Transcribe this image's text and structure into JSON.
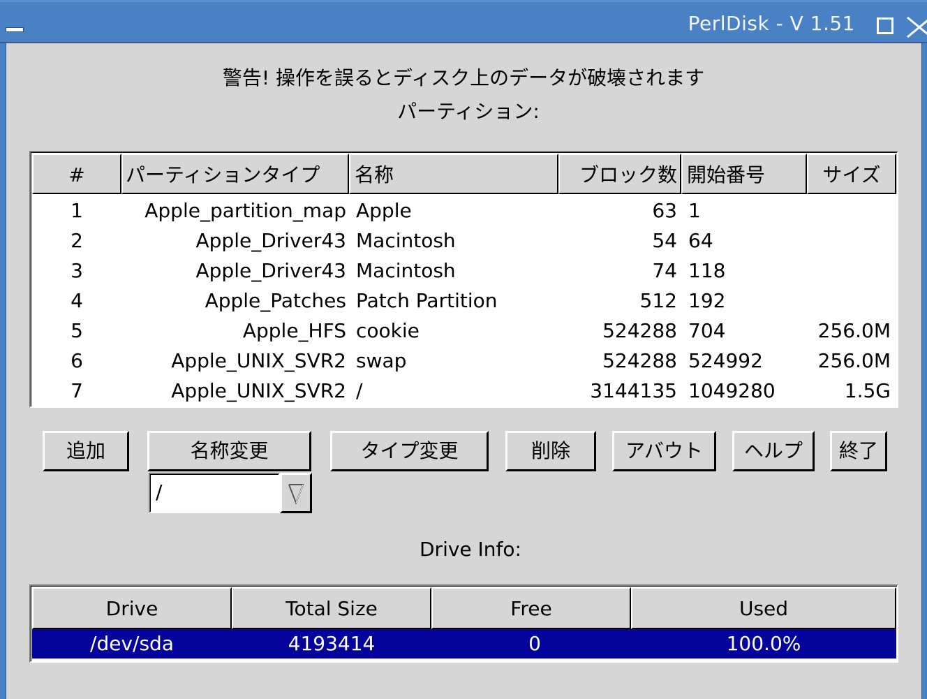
{
  "window": {
    "title": "PerlDisk - V 1.51"
  },
  "warning": "警告! 操作を誤るとディスク上のデータが破壊されます",
  "partitions_label": "パーティション:",
  "partition_table": {
    "headers": [
      "#",
      "パーティションタイプ",
      "名称",
      "ブロック数",
      "開始番号",
      "サイズ"
    ],
    "rows": [
      {
        "num": "1",
        "type": "Apple_partition_map",
        "name": "Apple",
        "blocks": "63",
        "start": "1",
        "size": ""
      },
      {
        "num": "2",
        "type": "Apple_Driver43",
        "name": "Macintosh",
        "blocks": "54",
        "start": "64",
        "size": ""
      },
      {
        "num": "3",
        "type": "Apple_Driver43",
        "name": "Macintosh",
        "blocks": "74",
        "start": "118",
        "size": ""
      },
      {
        "num": "4",
        "type": "Apple_Patches",
        "name": "Patch Partition",
        "blocks": "512",
        "start": "192",
        "size": ""
      },
      {
        "num": "5",
        "type": "Apple_HFS",
        "name": "cookie",
        "blocks": "524288",
        "start": "704",
        "size": "256.0M"
      },
      {
        "num": "6",
        "type": "Apple_UNIX_SVR2",
        "name": "swap",
        "blocks": "524288",
        "start": "524992",
        "size": "256.0M"
      },
      {
        "num": "7",
        "type": "Apple_UNIX_SVR2",
        "name": "/",
        "blocks": "3144135",
        "start": "1049280",
        "size": "1.5G"
      }
    ]
  },
  "buttons": {
    "add": "追加",
    "rename": "名称変更",
    "change_type": "タイプ変更",
    "delete": "削除",
    "about": "アバウト",
    "help": "ヘルプ",
    "quit": "終了"
  },
  "type_select": {
    "value": "/"
  },
  "drive_info_label": "Drive Info:",
  "drive_table": {
    "headers": [
      "Drive",
      "Total Size",
      "Free",
      "Used"
    ],
    "rows": [
      {
        "drive": "/dev/sda",
        "total": "4193414",
        "free": "0",
        "used": "100.0%"
      }
    ]
  },
  "colors": {
    "titlebar": "#4a80c4",
    "selection": "#04049c",
    "background": "#d6d6d6"
  }
}
